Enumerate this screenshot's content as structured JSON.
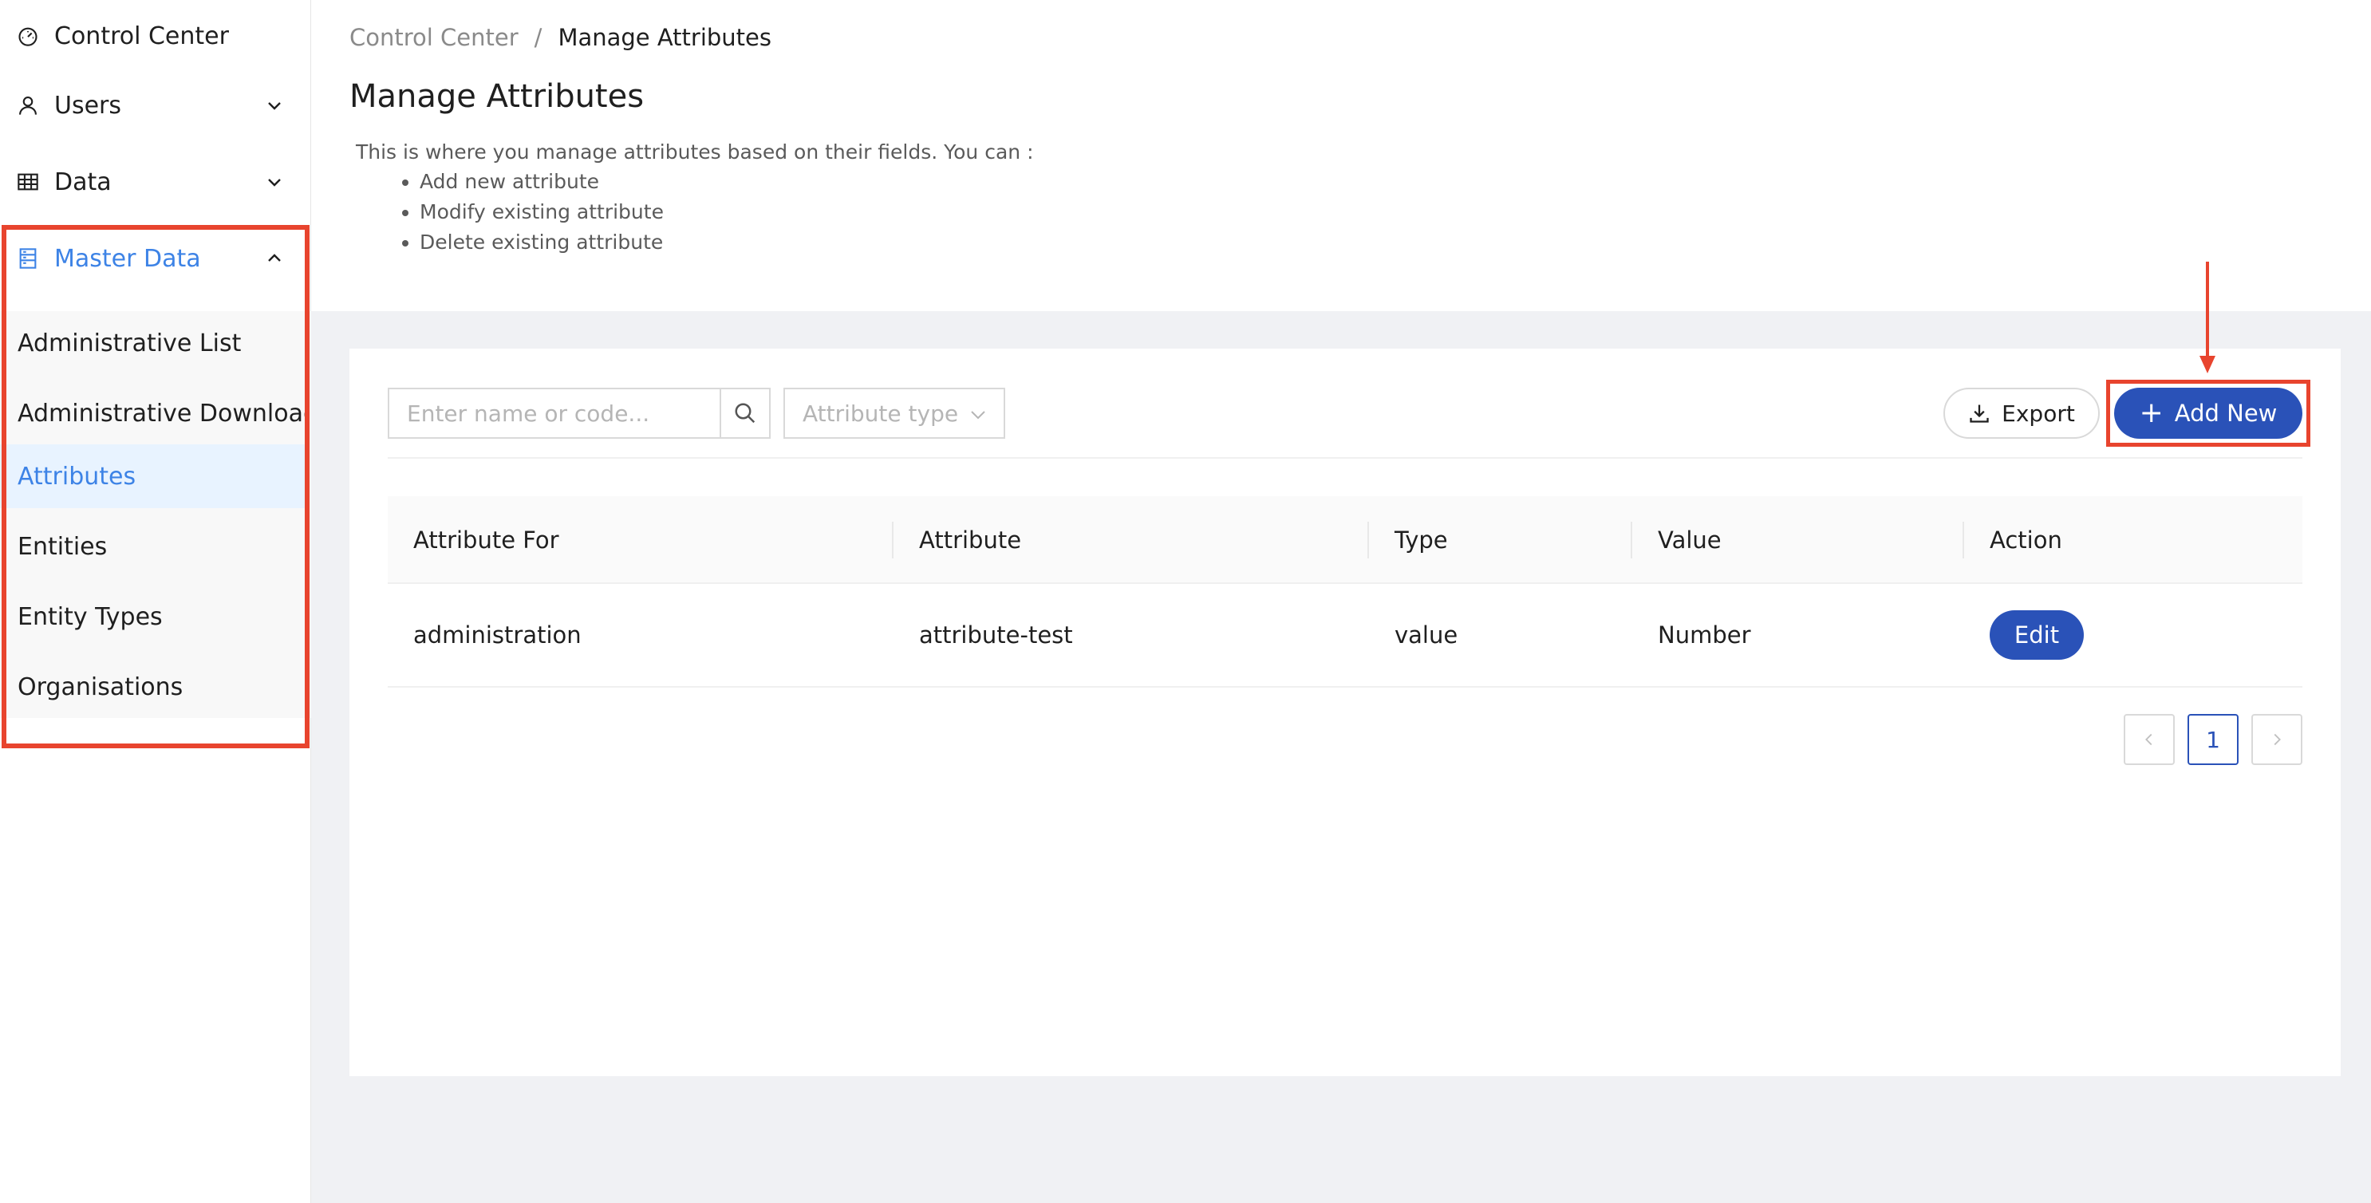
{
  "sidebar": {
    "items": [
      {
        "label": "Control Center",
        "icon": "dashboard-icon"
      },
      {
        "label": "Users",
        "icon": "user-icon"
      },
      {
        "label": "Data",
        "icon": "table-icon"
      },
      {
        "label": "Master Data",
        "icon": "server-icon"
      }
    ],
    "sub_items": [
      {
        "label": "Administrative List"
      },
      {
        "label": "Administrative Downloads"
      },
      {
        "label": "Attributes"
      },
      {
        "label": "Entities"
      },
      {
        "label": "Entity Types"
      },
      {
        "label": "Organisations"
      }
    ],
    "selected": "Attributes",
    "active_color": "#3d83e6"
  },
  "header": {
    "breadcrumb_root": "Control Center",
    "breadcrumb_sep": "/",
    "breadcrumb_current": "Manage Attributes",
    "title": "Manage Attributes",
    "description": "This is where you manage attributes based on their fields. You can :",
    "bullets": [
      "Add new attribute",
      "Modify existing attribute",
      "Delete existing attribute"
    ]
  },
  "toolbar": {
    "search_placeholder": "Enter name or code...",
    "type_placeholder": "Attribute type",
    "export_label": "Export",
    "add_label": "Add New",
    "primary_color": "#2a52b8",
    "highlight_color": "#e8442e"
  },
  "table": {
    "columns": [
      "Attribute For",
      "Attribute",
      "Type",
      "Value",
      "Action"
    ],
    "rows": [
      {
        "attribute_for": "administration",
        "attribute": "attribute-test",
        "type": "value",
        "value": "Number",
        "action": "Edit"
      }
    ]
  },
  "pagination": {
    "prev": "<",
    "current": "1",
    "next": ">"
  }
}
